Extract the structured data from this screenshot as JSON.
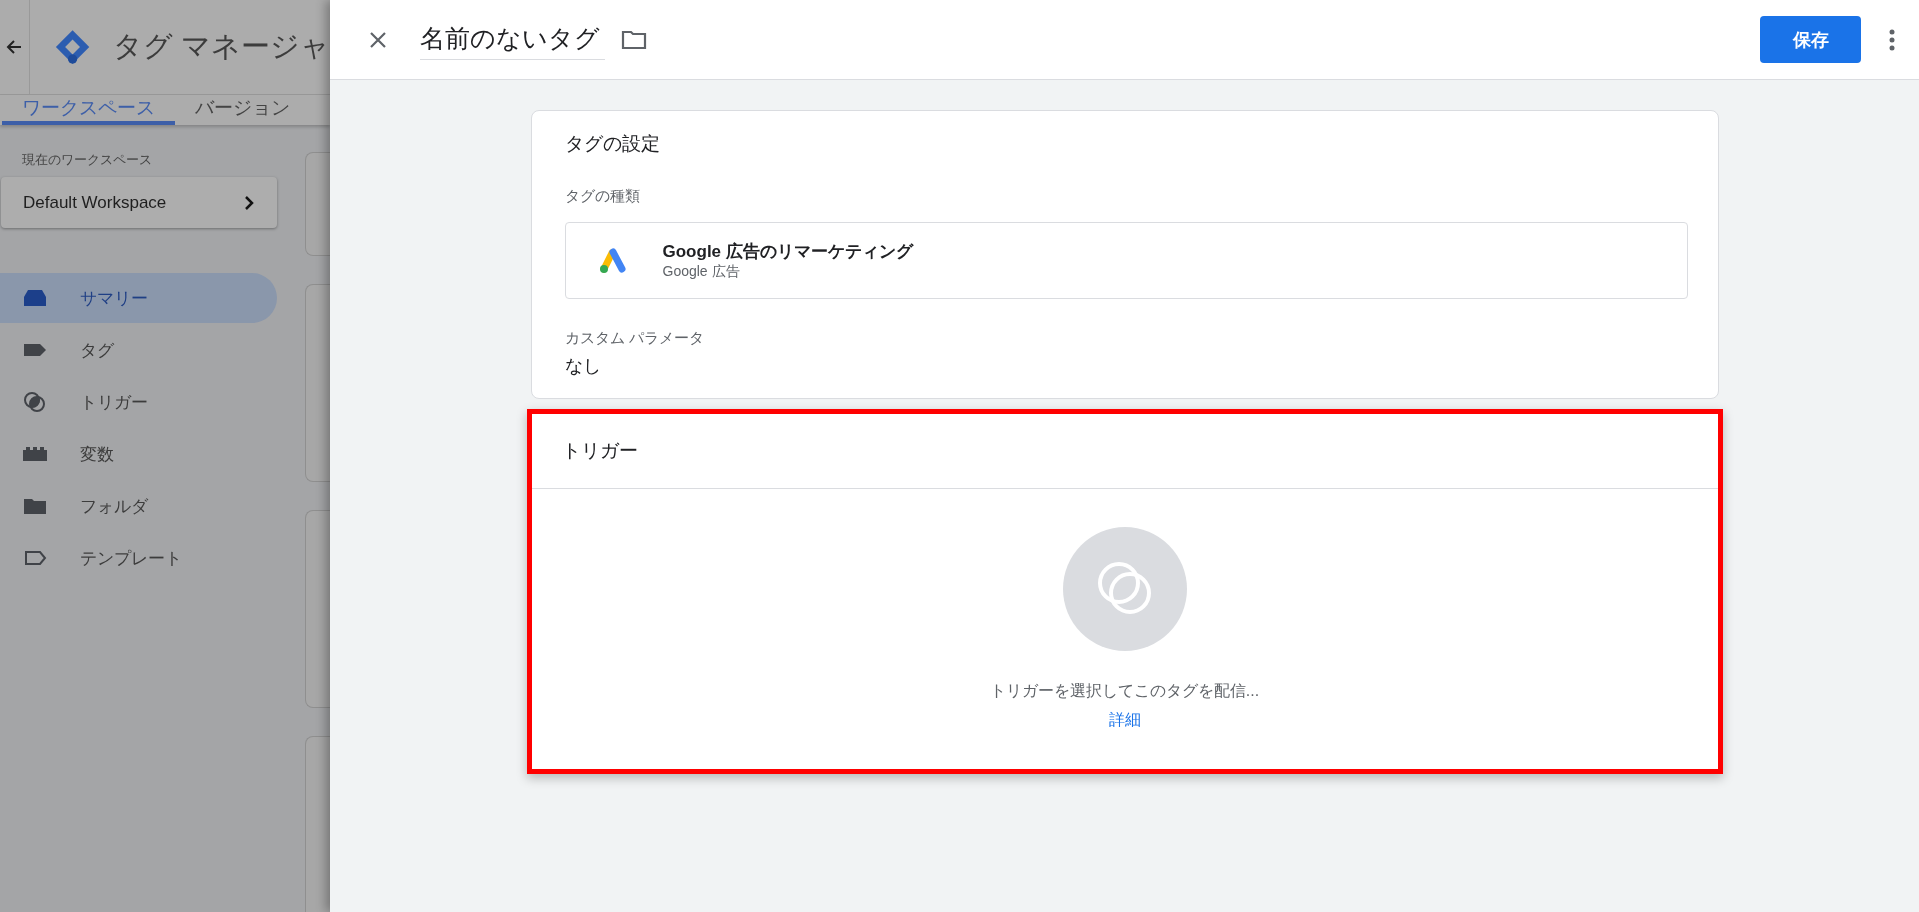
{
  "app_header": {
    "title": "タグ マネージャ"
  },
  "tabs": [
    {
      "label": "ワークスペース",
      "selected": true
    },
    {
      "label": "バージョン",
      "selected": false
    }
  ],
  "workspace": {
    "caption": "現在のワークスペース",
    "name": "Default Workspace"
  },
  "nav": [
    {
      "label": "サマリー",
      "kind": "summary",
      "selected": true
    },
    {
      "label": "タグ",
      "kind": "tag",
      "selected": false
    },
    {
      "label": "トリガー",
      "kind": "trigger",
      "selected": false
    },
    {
      "label": "変数",
      "kind": "variable",
      "selected": false
    },
    {
      "label": "フォルダ",
      "kind": "folder",
      "selected": false
    },
    {
      "label": "テンプレート",
      "kind": "template",
      "selected": false
    }
  ],
  "panel": {
    "tag_name": "名前のないタグ",
    "save": "保存"
  },
  "tag_config": {
    "title": "タグの設定",
    "type_label": "タグの種類",
    "type_name": "Google 広告のリマーケティング",
    "type_vendor": "Google 広告",
    "params_label": "カスタム パラメータ",
    "params_value": "なし"
  },
  "trigger": {
    "title": "トリガー",
    "highlighted": true,
    "hint": "トリガーを選択してこのタグを配信...",
    "link": "詳細"
  }
}
